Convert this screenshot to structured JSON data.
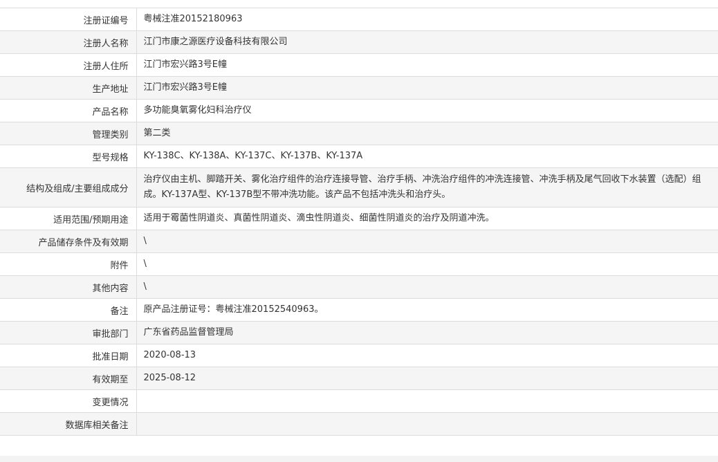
{
  "rows": [
    {
      "label": "注册证编号",
      "value": "粤械注准20152180963"
    },
    {
      "label": "注册人名称",
      "value": "江门市康之源医疗设备科技有限公司"
    },
    {
      "label": "注册人住所",
      "value": "江门市宏兴路3号E幢"
    },
    {
      "label": "生产地址",
      "value": "江门市宏兴路3号E幢"
    },
    {
      "label": "产品名称",
      "value": "多功能臭氧雾化妇科治疗仪"
    },
    {
      "label": "管理类别",
      "value": "第二类"
    },
    {
      "label": "型号规格",
      "value": "KY-138C、KY-138A、KY-137C、KY-137B、KY-137A"
    },
    {
      "label": "结构及组成/主要组成成分",
      "value": "治疗仪由主机、脚踏开关、雾化治疗组件的治疗连接导管、治疗手柄、冲洗治疗组件的冲洗连接管、冲洗手柄及尾气回收下水装置（选配）组成。KY-137A型、KY-137B型不带冲洗功能。该产品不包括冲洗头和治疗头。"
    },
    {
      "label": "适用范围/预期用途",
      "value": "适用于霉菌性阴道炎、真菌性阴道炎、滴虫性阴道炎、细菌性阴道炎的治疗及阴道冲洗。"
    },
    {
      "label": "产品储存条件及有效期",
      "value": "\\"
    },
    {
      "label": "附件",
      "value": "\\"
    },
    {
      "label": "其他内容",
      "value": "\\"
    },
    {
      "label": "备注",
      "value": "原产品注册证号：粤械注准20152540963。"
    },
    {
      "label": "审批部门",
      "value": "广东省药品监督管理局"
    },
    {
      "label": "批准日期",
      "value": "2020-08-13"
    },
    {
      "label": "有效期至",
      "value": "2025-08-12"
    },
    {
      "label": "变更情况",
      "value": ""
    },
    {
      "label": "数据库相关备注",
      "value": ""
    }
  ]
}
